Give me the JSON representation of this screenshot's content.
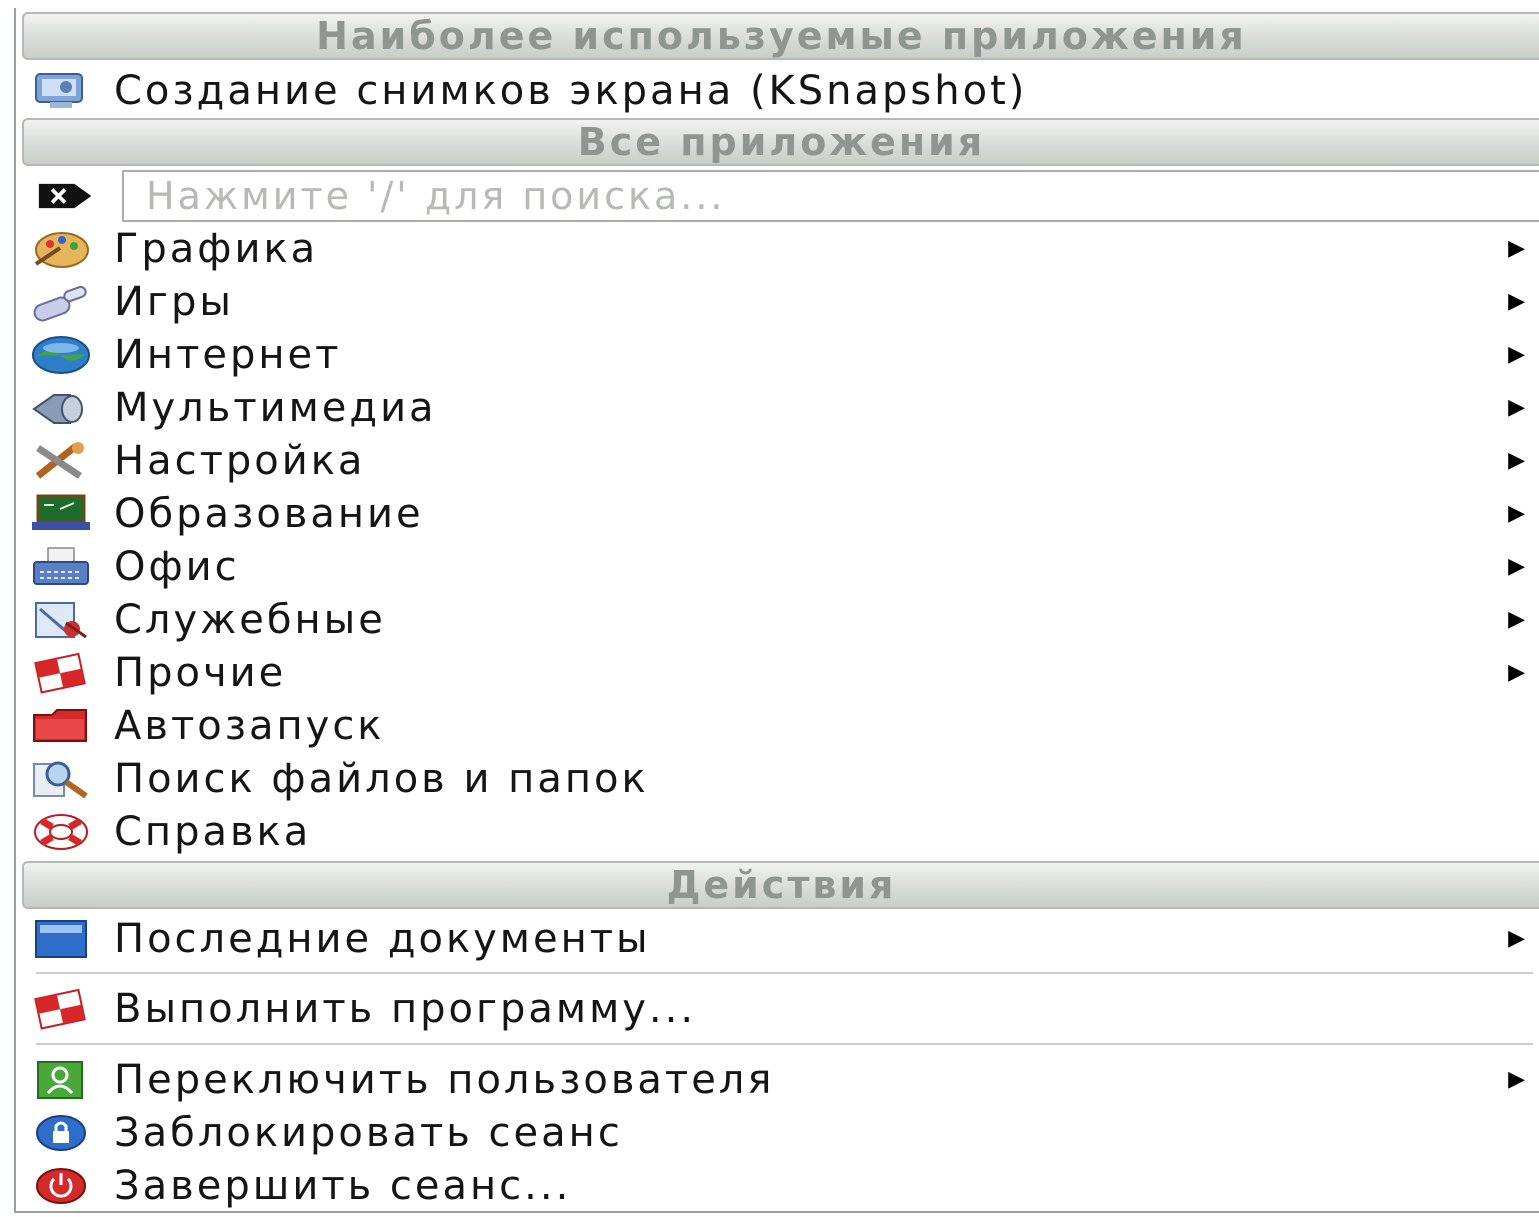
{
  "sections": {
    "most_used": "Наиболее используемые приложения",
    "all_apps": "Все приложения",
    "actions": "Действия"
  },
  "most_used_items": [
    {
      "label": "Создание снимков экрана (KSnapshot)",
      "icon": "camera-screen-icon"
    }
  ],
  "search": {
    "placeholder": "Нажмите '/' для поиска...",
    "value": "",
    "clear_icon": "clear-search-icon"
  },
  "categories": [
    {
      "label": "Графика",
      "icon": "palette-icon",
      "submenu": true
    },
    {
      "label": "Игры",
      "icon": "joystick-icon",
      "submenu": true
    },
    {
      "label": "Интернет",
      "icon": "globe-icon",
      "submenu": true
    },
    {
      "label": "Мультимедиа",
      "icon": "speaker-icon",
      "submenu": true
    },
    {
      "label": "Настройка",
      "icon": "tools-icon",
      "submenu": true
    },
    {
      "label": "Образование",
      "icon": "blackboard-icon",
      "submenu": true
    },
    {
      "label": "Офис",
      "icon": "typewriter-icon",
      "submenu": true
    },
    {
      "label": "Служебные",
      "icon": "utilities-icon",
      "submenu": true
    },
    {
      "label": "Прочие",
      "icon": "misc-icon",
      "submenu": true
    },
    {
      "label": "Автозапуск",
      "icon": "folder-red-icon",
      "submenu": false
    },
    {
      "label": "Поиск файлов и папок",
      "icon": "magnifier-icon",
      "submenu": false
    },
    {
      "label": "Справка",
      "icon": "lifebuoy-icon",
      "submenu": false
    }
  ],
  "actions": {
    "recent_docs": {
      "label": "Последние документы",
      "icon": "recent-documents-icon",
      "submenu": true
    },
    "run": {
      "label": "Выполнить программу...",
      "icon": "run-program-icon"
    },
    "switch_user": {
      "label": "Переключить пользователя",
      "icon": "switch-user-icon",
      "submenu": true
    },
    "lock": {
      "label": "Заблокировать сеанс",
      "icon": "lock-icon"
    },
    "logout": {
      "label": "Завершить сеанс...",
      "icon": "power-icon"
    }
  },
  "submenu_arrow": "▶",
  "colors": {
    "header_bg": "#d9ddd9",
    "header_text": "#8f9590",
    "separator": "#c9cdc9"
  }
}
